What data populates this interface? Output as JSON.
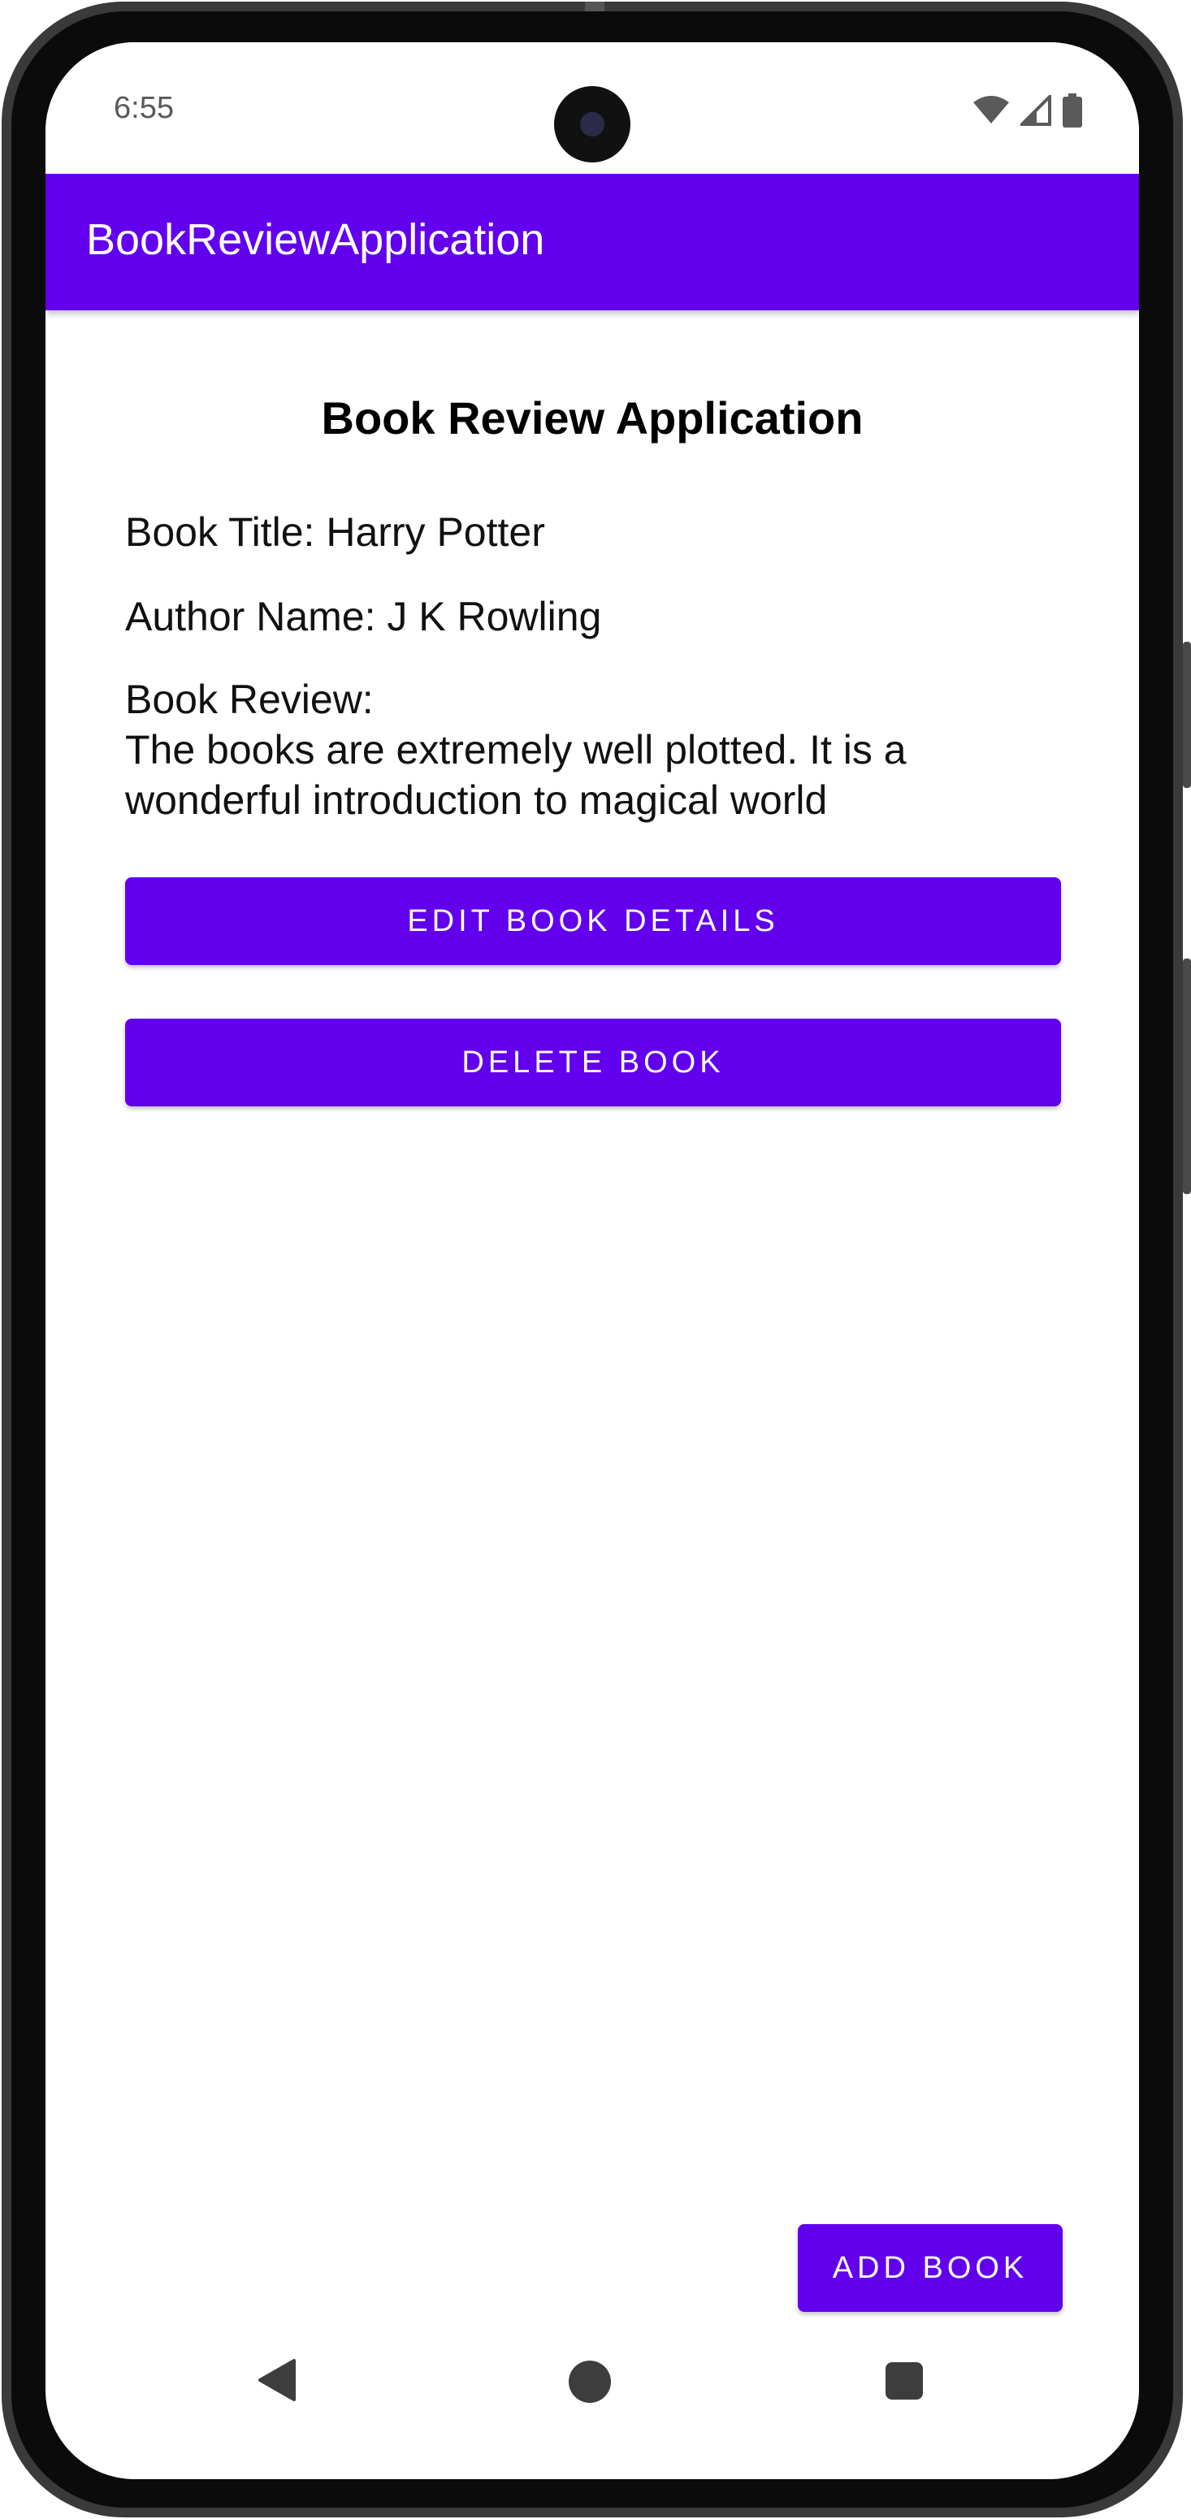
{
  "status_bar": {
    "time": "6:55"
  },
  "app_bar": {
    "title": "BookReviewApplication"
  },
  "main": {
    "heading": "Book Review Application",
    "book_title": "Book Title: Harry Potter",
    "author_name": "Author Name: J K Rowling",
    "review_label": "Book Review:",
    "review_text": "The books are extremely well plotted. It is a wonderful introduction to magical world",
    "edit_button": "EDIT BOOK DETAILS",
    "delete_button": "DELETE BOOK",
    "add_button": "ADD BOOK"
  },
  "colors": {
    "primary": "#6200ee",
    "on_primary": "#ffffff"
  },
  "icons": {
    "status": [
      "wifi-icon",
      "cellular-signal-icon",
      "battery-icon"
    ],
    "nav": [
      "back-icon",
      "home-icon",
      "recents-icon"
    ]
  }
}
